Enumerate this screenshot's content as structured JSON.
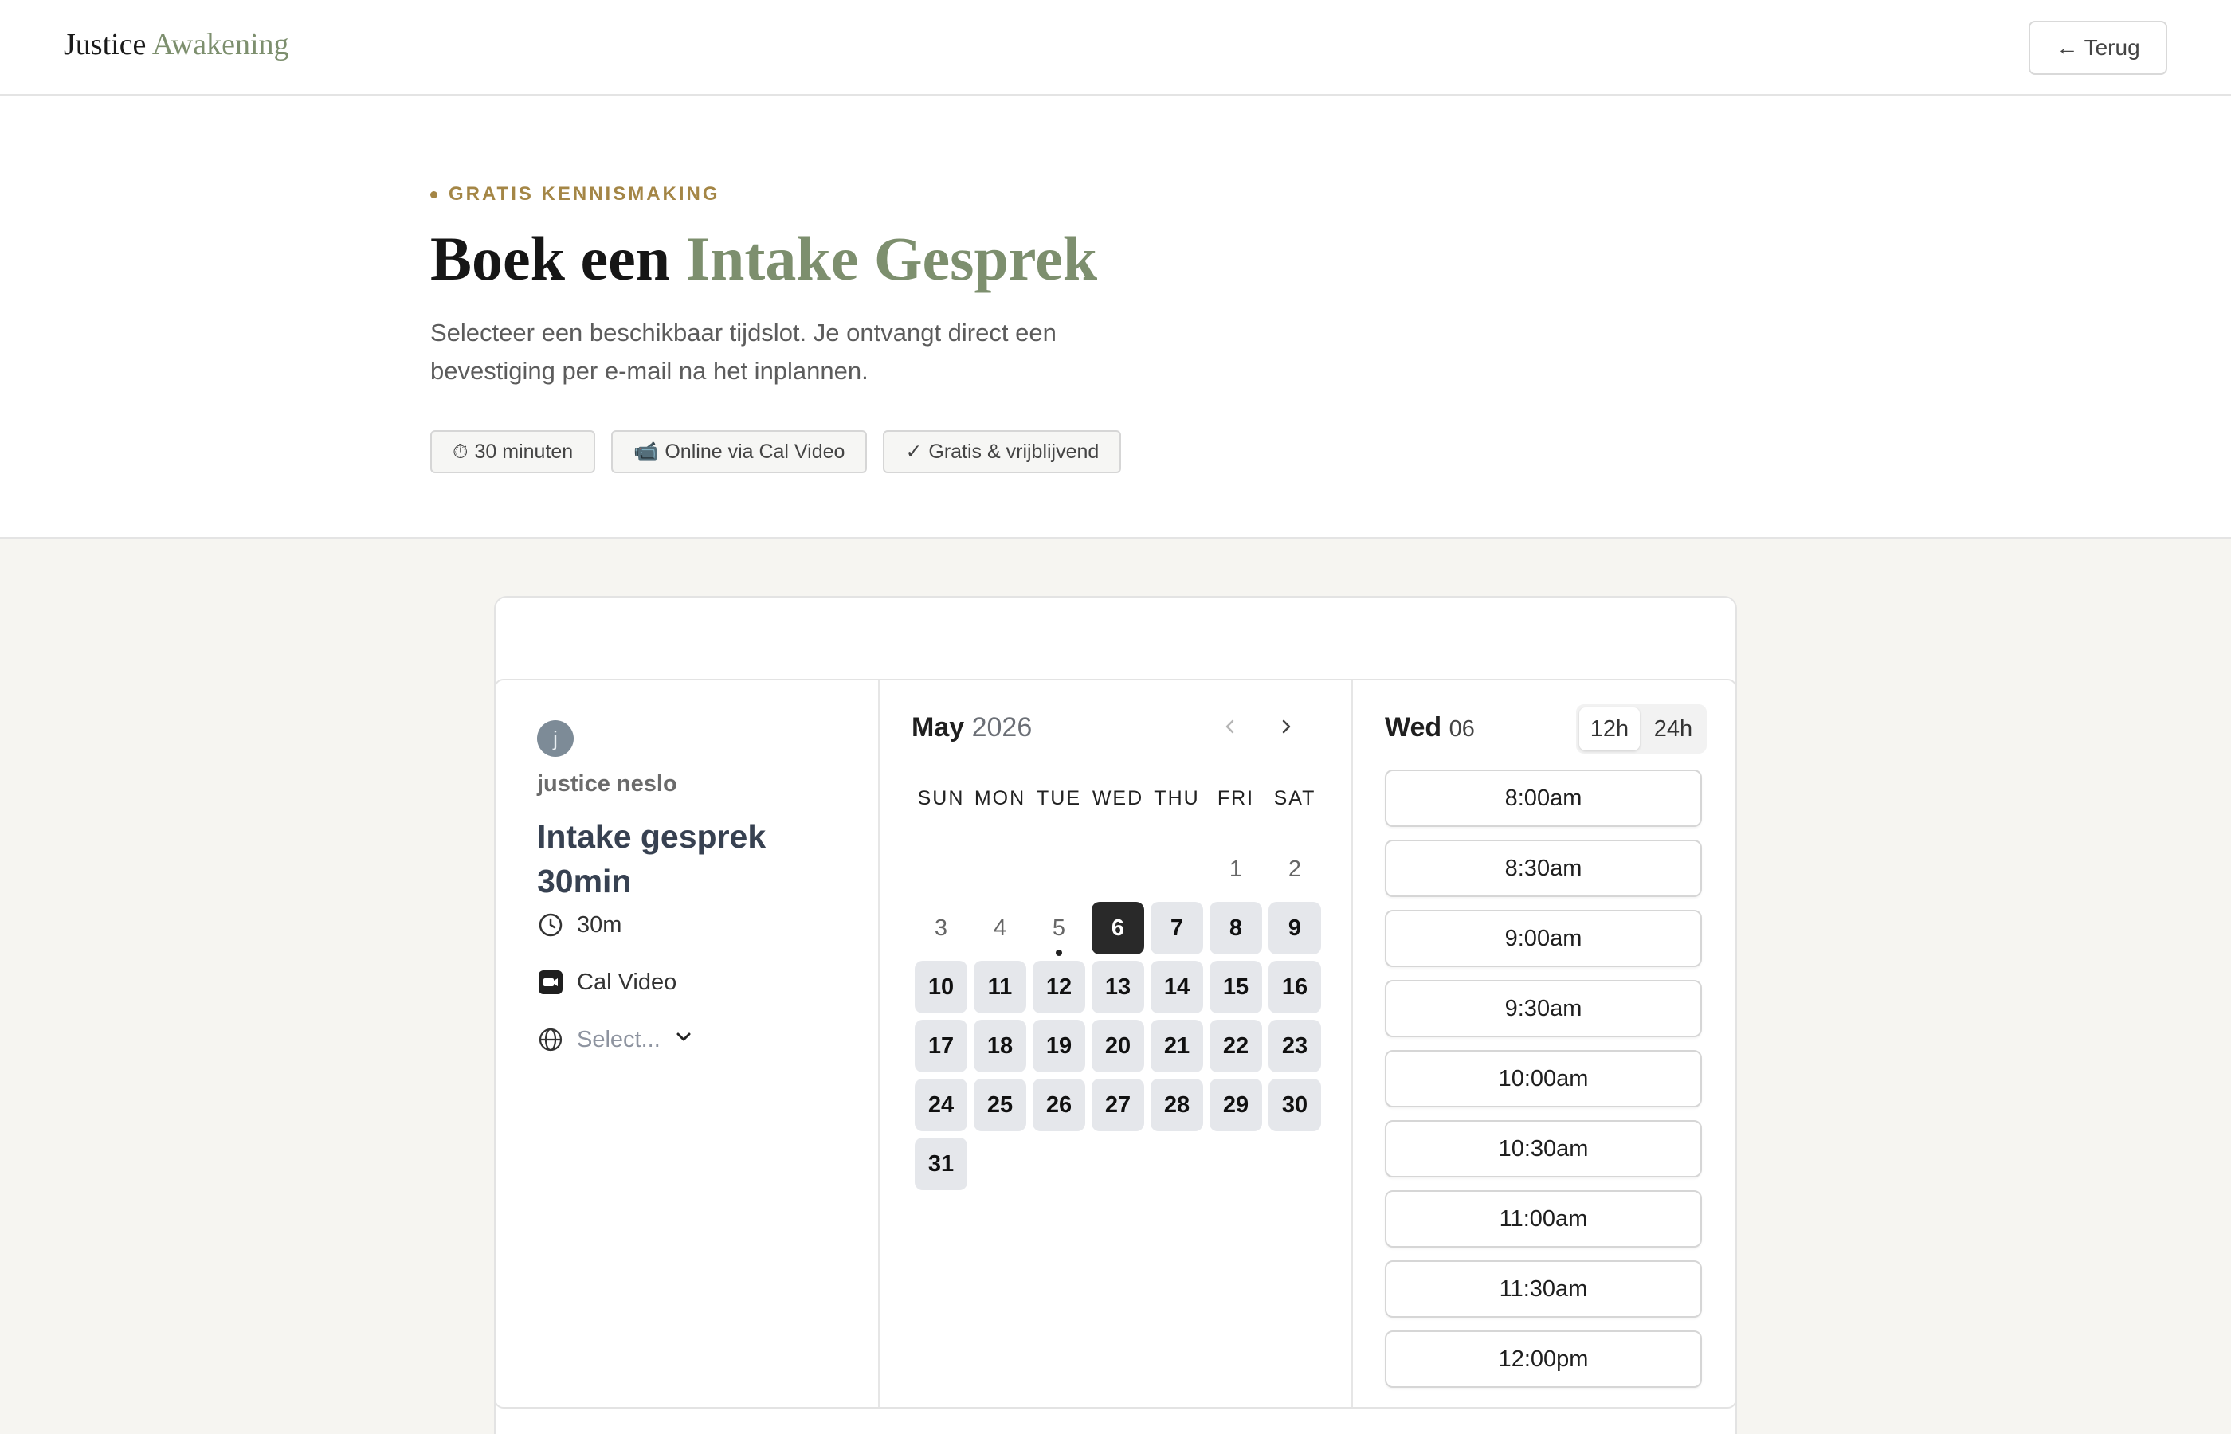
{
  "header": {
    "logo_main": "Justice",
    "logo_accent": "Awakening",
    "back_label": "← Terug"
  },
  "hero": {
    "eyebrow": "GRATIS KENNISMAKING",
    "title_main": "Boek een",
    "title_accent": "Intake Gesprek",
    "lead": "Selecteer een beschikbaar tijdslot. Je ontvangt direct een bevestiging per e-mail na het inplannen.",
    "chips": [
      {
        "icon": "⏱",
        "label": "30 minuten"
      },
      {
        "icon": "📹",
        "label": "Online via Cal Video"
      },
      {
        "icon": "✓",
        "label": "Gratis & vrijblijvend"
      }
    ]
  },
  "booker": {
    "avatar_initial": "j",
    "host_name": "justice neslo",
    "event_title": "Intake gesprek 30min",
    "duration": "30m",
    "location": "Cal Video",
    "timezone_placeholder": "Select...",
    "calendar": {
      "month": "May",
      "year": "2026",
      "weekdays": [
        "SUN",
        "MON",
        "TUE",
        "WED",
        "THU",
        "FRI",
        "SAT"
      ],
      "first_weekday_index": 5,
      "days_in_month": 31,
      "selected_day": 6,
      "today_day": 5,
      "first_available_day": 6
    },
    "slots": {
      "day_name": "Wed",
      "day_number": "06",
      "format_12h": "12h",
      "format_24h": "24h",
      "active_format": "12h",
      "times": [
        "8:00am",
        "8:30am",
        "9:00am",
        "9:30am",
        "10:00am",
        "10:30am",
        "11:00am",
        "11:30am",
        "12:00pm"
      ]
    }
  }
}
